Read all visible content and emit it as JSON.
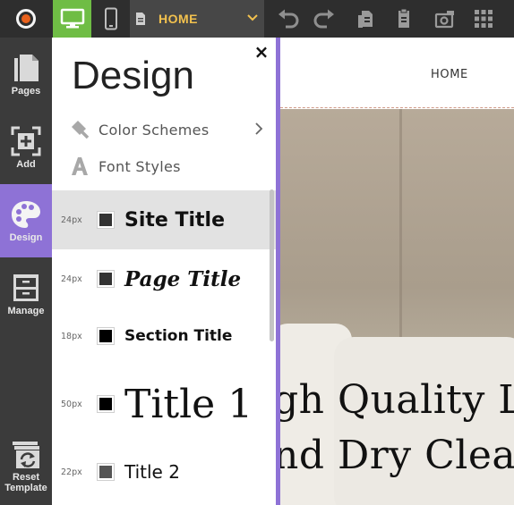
{
  "toolbar": {
    "logo_icon": "site-logo-icon",
    "desktop_icon": "desktop-monitor-icon",
    "mobile_icon": "mobile-phone-icon",
    "page_icon": "page-document-icon",
    "current_page": "HOME",
    "chevron_icon": "chevron-down-icon",
    "undo_icon": "undo-icon",
    "redo_icon": "redo-icon",
    "copy_page_icon": "copy-page-icon",
    "paste_page_icon": "paste-page-icon",
    "preview_icon": "preview-icon",
    "apps_icon": "apps-grid-icon",
    "accent_color": "#6fbd45",
    "page_name_color": "#f2c14e"
  },
  "sidebar": {
    "items": [
      {
        "label": "Pages",
        "icon": "pages-icon"
      },
      {
        "label": "Add",
        "icon": "add-icon"
      },
      {
        "label": "Design",
        "icon": "palette-icon",
        "active": true
      },
      {
        "label": "Manage",
        "icon": "manage-drawer-icon"
      }
    ],
    "reset": {
      "line1": "Reset",
      "line2": "Template",
      "icon": "reset-template-icon"
    },
    "active_color": "#8e72d6"
  },
  "panel": {
    "title": "Design",
    "close_label": "×",
    "menu": [
      {
        "label": "Color Schemes",
        "icon": "paint-brush-icon",
        "has_arrow": true
      },
      {
        "label": "Font Styles",
        "icon": "font-a-icon"
      }
    ],
    "font_rows": [
      {
        "size": "24px",
        "sample": "Site Title",
        "swatch_color": "#333333",
        "selected": true
      },
      {
        "size": "24px",
        "sample": "Page Title",
        "swatch_color": "#333333"
      },
      {
        "size": "18px",
        "sample": "Section Title",
        "swatch_color": "#000000"
      },
      {
        "size": "50px",
        "sample": "Title 1",
        "swatch_color": "#000000"
      },
      {
        "size": "22px",
        "sample": "Title 2",
        "swatch_color": "#555555"
      }
    ]
  },
  "canvas": {
    "nav_home": "HOME",
    "hero_line1": "gh Quality L",
    "hero_line2": "nd Dry Clean"
  }
}
